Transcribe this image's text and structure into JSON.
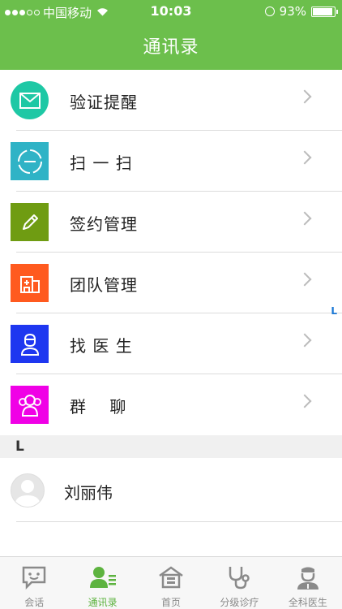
{
  "status_bar": {
    "carrier": "中国移动",
    "time": "10:03",
    "battery": "93%",
    "signal_dots_filled": 3,
    "signal_dots_total": 5
  },
  "header": {
    "title": "通讯录"
  },
  "menu": [
    {
      "label": "验证提醒",
      "icon": "envelope-icon",
      "color": "#1ec8a5"
    },
    {
      "label": "扫 一 扫",
      "icon": "scan-icon",
      "color": "#2fb3c6"
    },
    {
      "label": "签约管理",
      "icon": "pen-icon",
      "color": "#6f9c12"
    },
    {
      "label": "团队管理",
      "icon": "hospital-icon",
      "color": "#ff5a1f"
    },
    {
      "label": "找 医 生",
      "icon": "doctor-icon",
      "color": "#1e37f0"
    },
    {
      "label": "群　 聊",
      "icon": "group-icon",
      "color": "#f000e6"
    }
  ],
  "section": {
    "letter": "L"
  },
  "index": {
    "letter": "L"
  },
  "contacts": [
    {
      "name": "刘丽伟"
    }
  ],
  "tabs": [
    {
      "label": "会话",
      "icon": "chat-icon",
      "active": false
    },
    {
      "label": "通讯录",
      "icon": "contacts-icon",
      "active": true
    },
    {
      "label": "首页",
      "icon": "home-icon",
      "active": false
    },
    {
      "label": "分级诊疗",
      "icon": "stethoscope-icon",
      "active": false
    },
    {
      "label": "全科医生",
      "icon": "nurse-icon",
      "active": false
    }
  ],
  "colors": {
    "header": "#6cbf4c",
    "active_tab": "#5db33f",
    "index_letter": "#1a78d6"
  }
}
